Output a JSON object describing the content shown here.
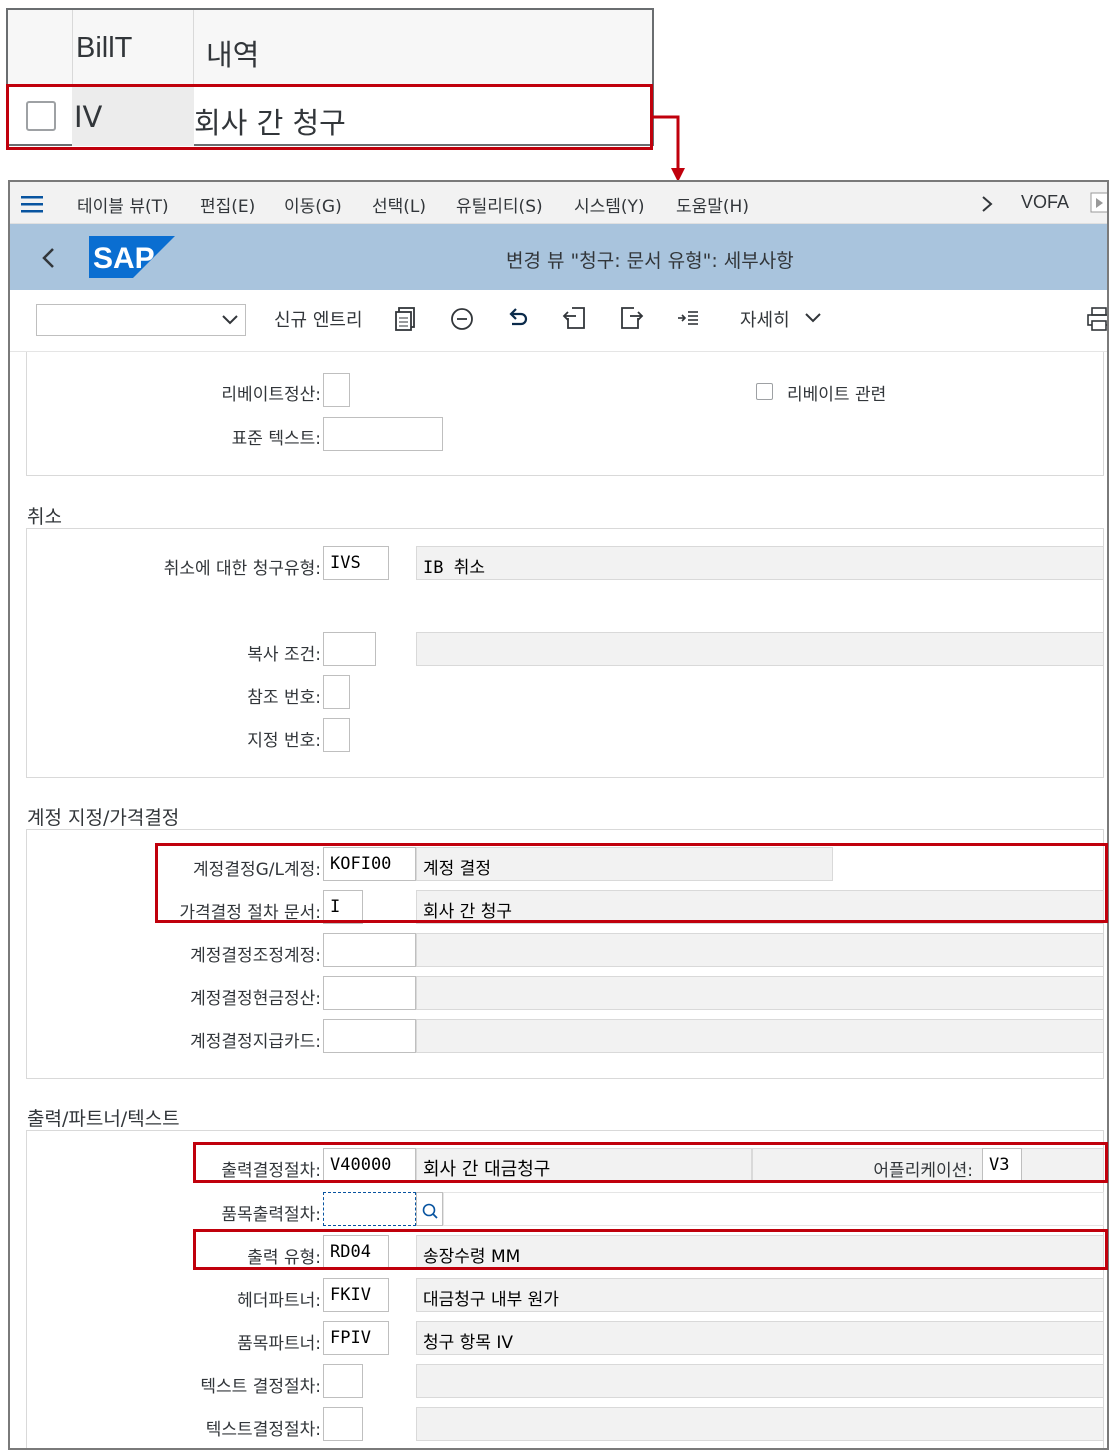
{
  "table": {
    "col_billt": "BillT",
    "col_desc": "내역",
    "row_billt": "IV",
    "row_desc": "회사 간 청구"
  },
  "menu": {
    "items": [
      "테이블 뷰(T)",
      "편집(E)",
      "이동(G)",
      "선택(L)",
      "유틸리티(S)",
      "시스템(Y)",
      "도움말(H)"
    ],
    "system_id": "VOFA"
  },
  "header": {
    "logo": "SAP",
    "title": "변경 뷰 \"청구: 문서 유형\": 세부사항"
  },
  "toolbar": {
    "new_entry": "신규 엔트리",
    "more": "자세히"
  },
  "section_top": {
    "rebate_settlement_label": "리베이트정산:",
    "rebate_relevant_label": "리베이트 관련",
    "standard_text_label": "표준 텍스트:"
  },
  "cancel": {
    "title": "취소",
    "cancel_billtype_label": "취소에 대한 청구유형:",
    "cancel_billtype_value": "IVS",
    "cancel_billtype_desc": "IB 취소",
    "copy_cond_label": "복사 조건:",
    "ref_no_label": "참조 번호:",
    "assign_no_label": "지정 번호:"
  },
  "account": {
    "title": "계정 지정/가격결정",
    "gl_label": "계정결정G/L계정:",
    "gl_value": "KOFI00",
    "gl_desc": "계정 결정",
    "pricing_label": "가격결정 절차 문서:",
    "pricing_value": "I",
    "pricing_desc": "회사 간 청구",
    "recon_label": "계정결정조정계정:",
    "cash_label": "계정결정현금정산:",
    "card_label": "계정결정지급카드:"
  },
  "output": {
    "title": "출력/파트너/텍스트",
    "out_proc_label": "출력결정절차:",
    "out_proc_value": "V40000",
    "out_proc_desc": "회사 간 대금청구",
    "app_label": "어플리케이션:",
    "app_value": "V3",
    "item_out_label": "품목출력절차:",
    "out_type_label": "출력 유형:",
    "out_type_value": "RD04",
    "out_type_desc": "송장수령 MM",
    "hdr_partner_label": "헤더파트너:",
    "hdr_partner_value": "FKIV",
    "hdr_partner_desc": "대금청구 내부 원가",
    "item_partner_label": "품목파트너:",
    "item_partner_value": "FPIV",
    "item_partner_desc": "청구 항목 IV",
    "text_proc_label": "텍스트 결정절차:",
    "text_proc2_label": "텍스트결정절차:"
  },
  "colors": {
    "highlight": "#c0000c",
    "shell_header": "#a9c4dd",
    "sap_blue": "#0a6ed1"
  }
}
